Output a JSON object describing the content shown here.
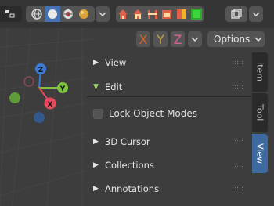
{
  "toolbar": {
    "icons": [
      "shading-icon",
      "global-view-icon",
      "solid-shading-icon",
      "material-shading-icon",
      "rendered-shading-icon"
    ],
    "accent": "#4772b3"
  },
  "axes": {
    "x_label": "X",
    "y_label": "Y",
    "z_label": "Z",
    "x_color": "#d9602e",
    "y_color": "#c2a43b",
    "z_color": "#d66392"
  },
  "options": {
    "label": "Options"
  },
  "gizmo": {
    "x": "X",
    "y": "Y",
    "z": "Z"
  },
  "panels": [
    {
      "label": "View",
      "expanded": false
    },
    {
      "label": "Edit",
      "expanded": true
    },
    {
      "label": "3D Cursor",
      "expanded": false
    },
    {
      "label": "Collections",
      "expanded": false
    },
    {
      "label": "Annotations",
      "expanded": false
    }
  ],
  "edit": {
    "lock_label": "Lock Object Modes",
    "lock_checked": false
  },
  "tabs": [
    {
      "label": "Item",
      "active": false
    },
    {
      "label": "Tool",
      "active": false
    },
    {
      "label": "View",
      "active": true
    }
  ]
}
